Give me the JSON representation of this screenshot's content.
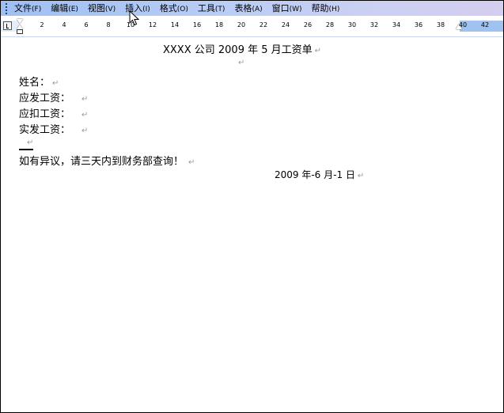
{
  "menu": {
    "items": [
      {
        "label": "文件",
        "accel": "(F)"
      },
      {
        "label": "编辑",
        "accel": "(E)"
      },
      {
        "label": "视图",
        "accel": "(V)"
      },
      {
        "label": "插入",
        "accel": "(I)"
      },
      {
        "label": "格式",
        "accel": "(O)"
      },
      {
        "label": "工具",
        "accel": "(T)"
      },
      {
        "label": "表格",
        "accel": "(A)"
      },
      {
        "label": "窗口",
        "accel": "(W)"
      },
      {
        "label": "帮助",
        "accel": "(H)"
      }
    ]
  },
  "ruler": {
    "numbers": [
      "2",
      "4",
      "6",
      "8",
      "10",
      "12",
      "14",
      "16",
      "18",
      "20",
      "22",
      "24",
      "26",
      "28",
      "30",
      "32",
      "34",
      "36",
      "38",
      "40",
      "42"
    ]
  },
  "document": {
    "title": "XXXX 公司 2009 年 5 月工资单",
    "lines": [
      "姓名：",
      "应发工资：",
      "应扣工资：",
      "实发工资："
    ],
    "notice": "如有异议，请三天内到财务部查询！",
    "date": "2009 年-6 月-1 日",
    "para_mark": "↵"
  },
  "colors": {
    "menubar_start": "#9fbff3",
    "menubar_end": "#d4cef0",
    "ruler_band": "#e6eefb",
    "ruler_right": "#9fc3ee",
    "paragraph_mark": "#9a9a9a"
  }
}
